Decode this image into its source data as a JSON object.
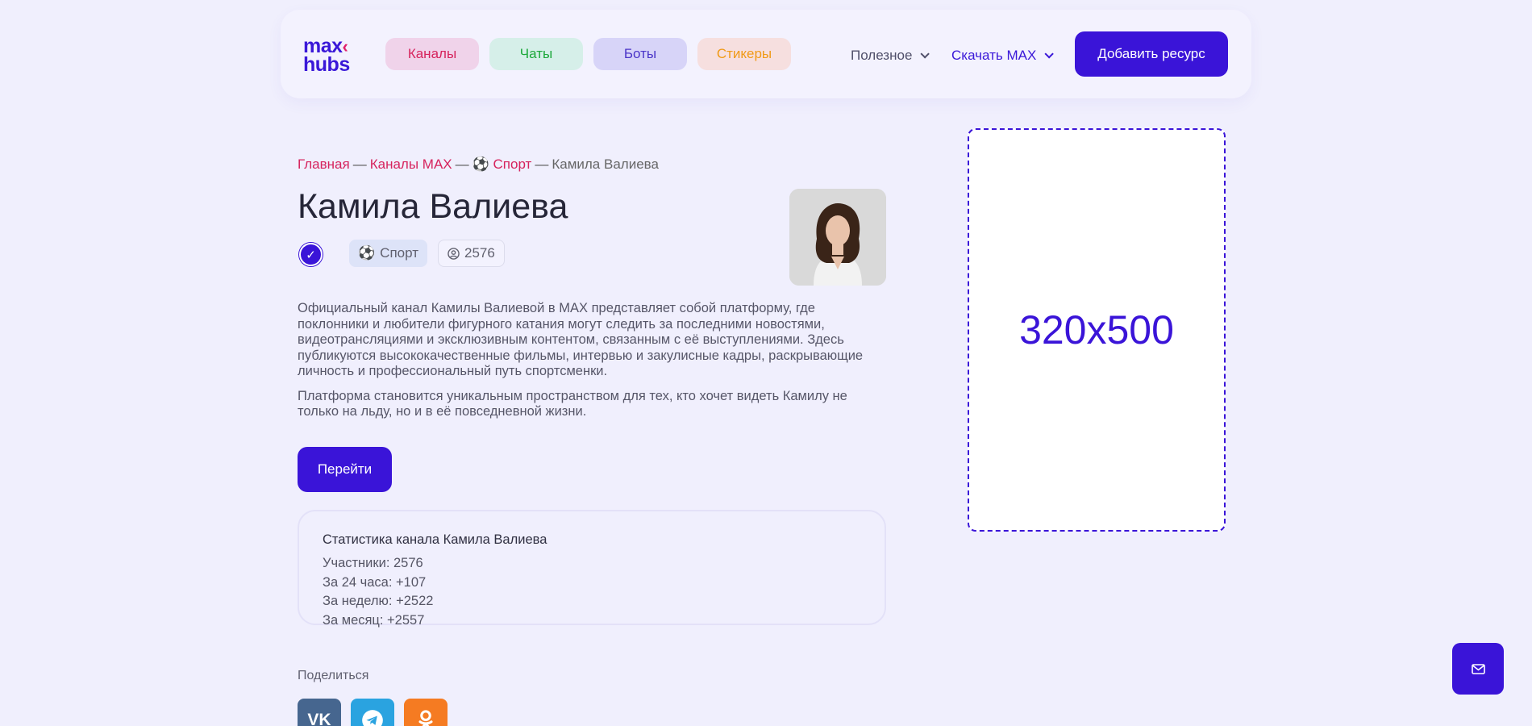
{
  "header": {
    "logo_line1": "max",
    "logo_mark": "‹",
    "logo_line2": "hubs",
    "pills": {
      "channels": "Каналы",
      "chats": "Чаты",
      "bots": "Боты",
      "stickers": "Стикеры"
    },
    "useful": "Полезное",
    "download": "Скачать MAX",
    "add_resource": "Добавить ресурс"
  },
  "breadcrumb": {
    "home": "Главная",
    "channels": "Каналы MAX",
    "category_icon": "⚽",
    "category": "Спорт",
    "current": "Камила Валиева",
    "separator": "—"
  },
  "channel": {
    "title": "Камила Валиева",
    "verified_icon": "✓",
    "category_icon": "⚽",
    "category": "Спорт",
    "members_count": "2576",
    "description": [
      "Официальный канал Камилы Валиевой в MAX представляет собой платформу, где поклонники и любители фигурного катания могут следить за последними новостями, видеотрансляциями и эксклюзивным контентом, связанным с её выступлениями. Здесь публикуются высококачественные фильмы, интервью и закулисные кадры, раскрывающие личность и профессиональный путь спортсменки.",
      "Платформа становится уникальным пространством для тех, кто хочет видеть Камилу не только на льду, но и в её повседневной жизни."
    ],
    "go_button": "Перейти"
  },
  "stats": {
    "title": "Статистика канала Камила Валиева",
    "members": "Участники: 2576",
    "day": "За 24 часа: +107",
    "week": "За неделю: +2522",
    "month": "За месяц: +2557"
  },
  "share": {
    "label": "Поделиться",
    "vk": "vk-icon",
    "telegram": "telegram-icon",
    "ok": "odnoklassniki-icon"
  },
  "ad": {
    "label": "320x500"
  },
  "fab_icon": "mail-icon",
  "colors": {
    "accent": "#3a14d8",
    "link": "#d6245d",
    "background": "#f0effd"
  }
}
